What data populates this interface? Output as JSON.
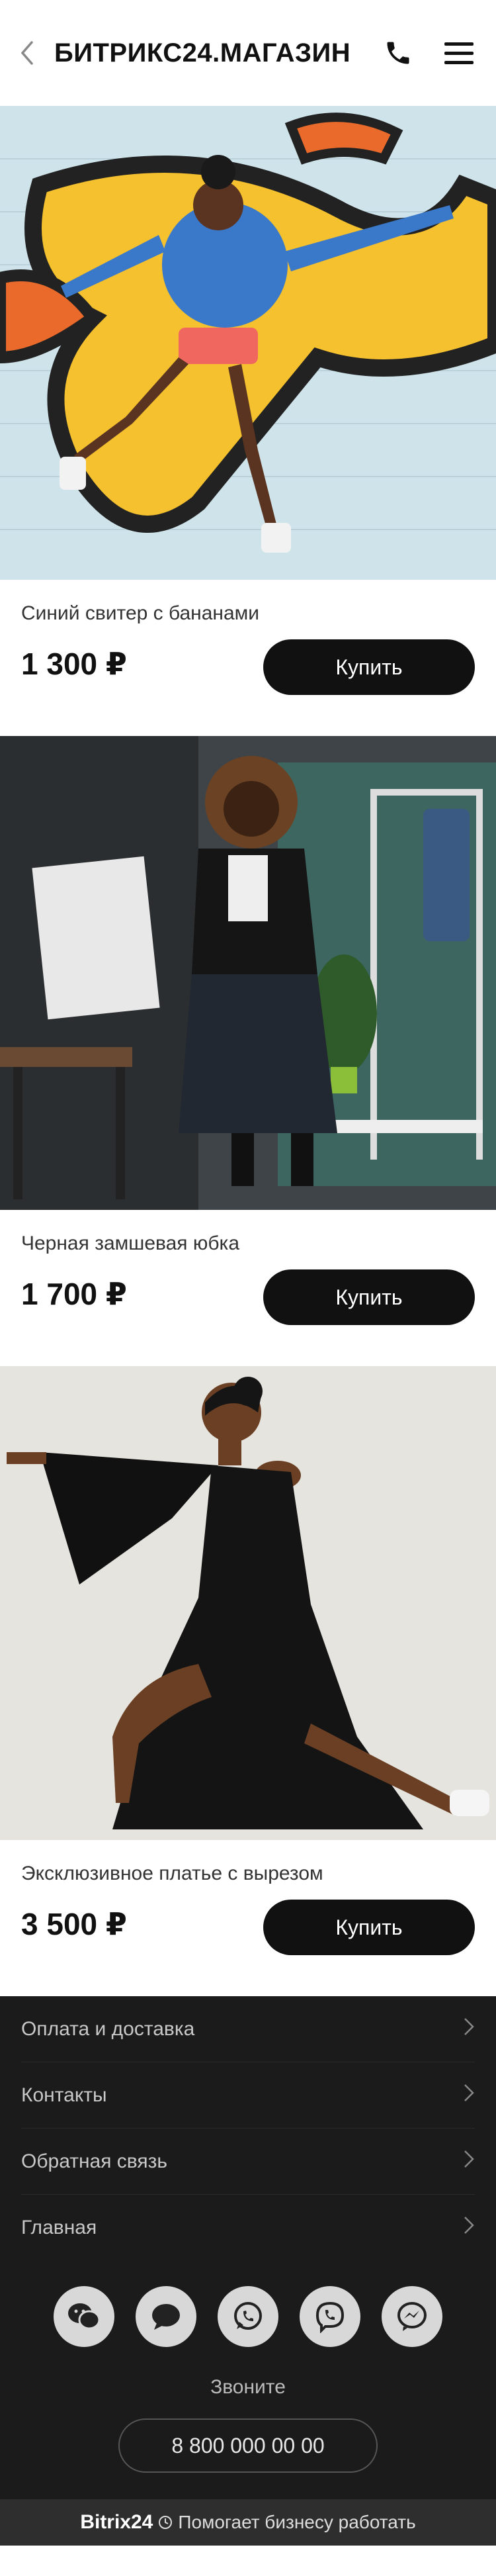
{
  "header": {
    "title": "БИТРИКС24.МАГАЗИН"
  },
  "products": [
    {
      "name": "Синий свитер с бананами",
      "price": "1 300 ₽",
      "buy_label": "Купить"
    },
    {
      "name": "Черная замшевая юбка",
      "price": "1 700 ₽",
      "buy_label": "Купить"
    },
    {
      "name": "Эксклюзивное платье с вырезом",
      "price": "3 500 ₽",
      "buy_label": "Купить"
    }
  ],
  "footer": {
    "menu": [
      {
        "label": "Оплата и доставка"
      },
      {
        "label": "Контакты"
      },
      {
        "label": "Обратная связь"
      },
      {
        "label": "Главная"
      }
    ],
    "socials": [
      "wechat-icon",
      "chat-icon",
      "whatsapp-icon",
      "viber-icon",
      "messenger-icon"
    ],
    "call_label": "Звоните",
    "phone": "8 800 000 00 00",
    "brand": "Bitrix24",
    "tagline": "Помогает бизнесу работать"
  },
  "colors": {
    "button_bg": "#111111",
    "footer_bg": "#1b1b1b",
    "accent_yellow": "#f5c12e"
  }
}
